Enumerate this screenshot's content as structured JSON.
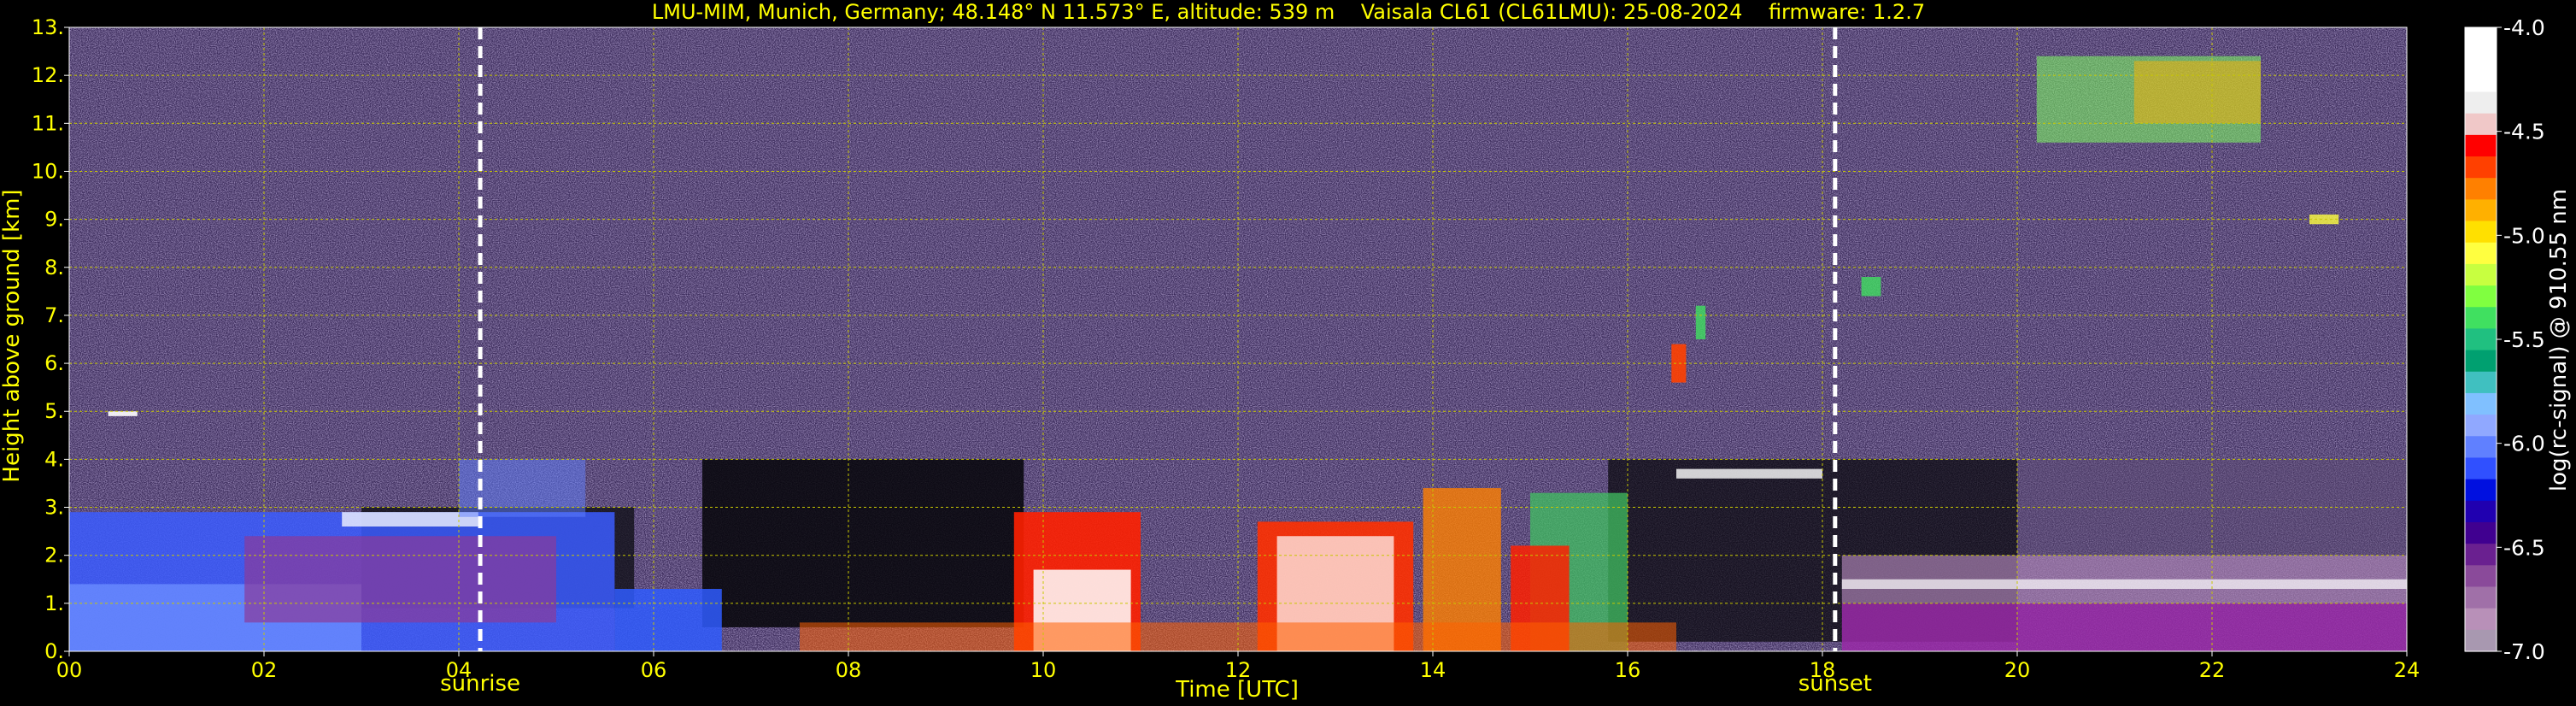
{
  "chart_data": {
    "type": "heatmap",
    "title": "LMU-MIM, Munich, Germany; 48.148° N 11.573° E, altitude: 539 m    Vaisala CL61 (CL61LMU): 25-08-2024    firmware: 1.2.7",
    "xlabel": "Time [UTC]",
    "ylabel": "Height above ground [km]",
    "xlim": [
      0,
      24
    ],
    "ylim": [
      0,
      13
    ],
    "x_ticks": [
      "00",
      "02",
      "04",
      "06",
      "08",
      "10",
      "12",
      "14",
      "16",
      "18",
      "20",
      "22",
      "24"
    ],
    "y_ticks": [
      "0.",
      "1.",
      "2.",
      "3.",
      "4.",
      "5.",
      "6.",
      "7.",
      "8.",
      "9.",
      "10.",
      "11.",
      "12.",
      "13."
    ],
    "grid": true,
    "colorbar": {
      "label": "log(rc-signal) @ 910.55 nm",
      "range": [
        -7.0,
        -4.0
      ],
      "ticks": [
        "-4.0",
        "-4.5",
        "-5.0",
        "-5.5",
        "-6.0",
        "-6.5",
        "-7.0"
      ],
      "colors": [
        "#ffffff",
        "#ffffff",
        "#ffffff",
        "#eeeeee",
        "#f0c8c8",
        "#ff0000",
        "#ff4000",
        "#ff8000",
        "#ffb000",
        "#ffe000",
        "#ffff40",
        "#c8ff40",
        "#80ff40",
        "#40e060",
        "#20c080",
        "#00a070",
        "#40c0c0",
        "#80c0ff",
        "#90a8ff",
        "#6080ff",
        "#3050ff",
        "#0010e0",
        "#2000b0",
        "#400090",
        "#6a2090",
        "#8a4a9a",
        "#a070a8",
        "#b890b8",
        "#a898b0"
      ]
    },
    "events": [
      {
        "name": "sunrise",
        "time": 4.22
      },
      {
        "name": "sunset",
        "time": 18.13
      }
    ]
  },
  "colors": {
    "text": "#ffff00",
    "grid": "#c8c800",
    "background": "#000000",
    "noise_base": "#3c2c5c"
  }
}
